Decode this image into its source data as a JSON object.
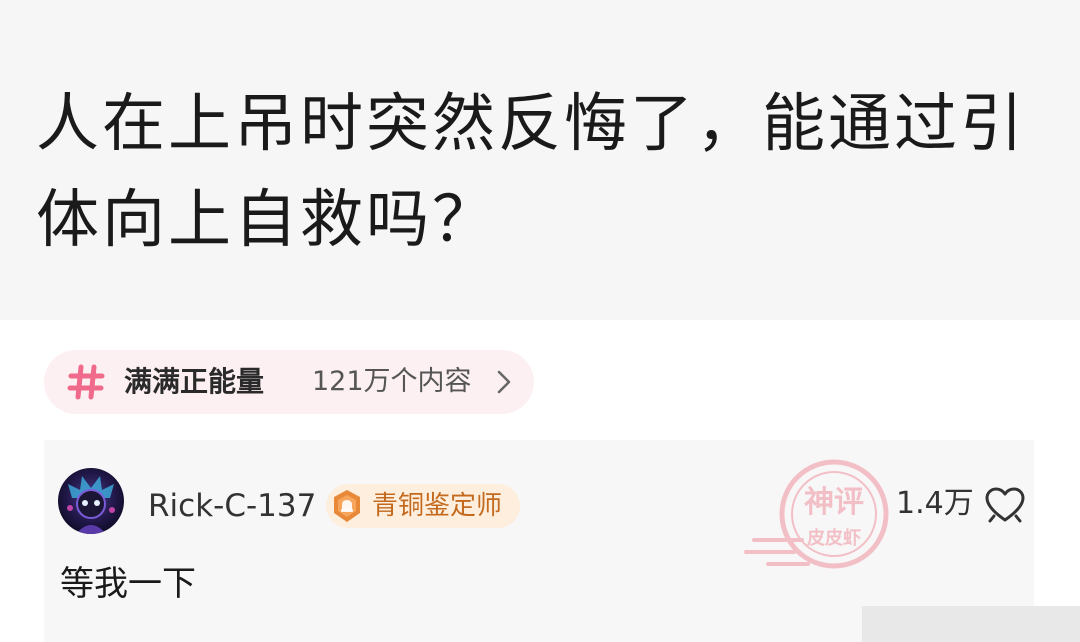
{
  "post": {
    "title": "人在上吊时突然反悔了，能通过引体向上自救吗？"
  },
  "topic": {
    "icon": "hashtag-icon",
    "name": "满满正能量",
    "count": "121万个内容",
    "accent_color": "#f06b8b"
  },
  "comment": {
    "avatar": "user-avatar",
    "username": "Rick-C-137",
    "badge": {
      "icon": "bronze-medal-icon",
      "label": "青铜鉴定师",
      "color": "#e8893a"
    },
    "likes": "1.4万",
    "like_icon": "heart-outline-icon",
    "text": "等我一下"
  },
  "watermark": {
    "text_top": "神评",
    "text_bottom": "皮皮虾",
    "color": "#f07c8c"
  }
}
